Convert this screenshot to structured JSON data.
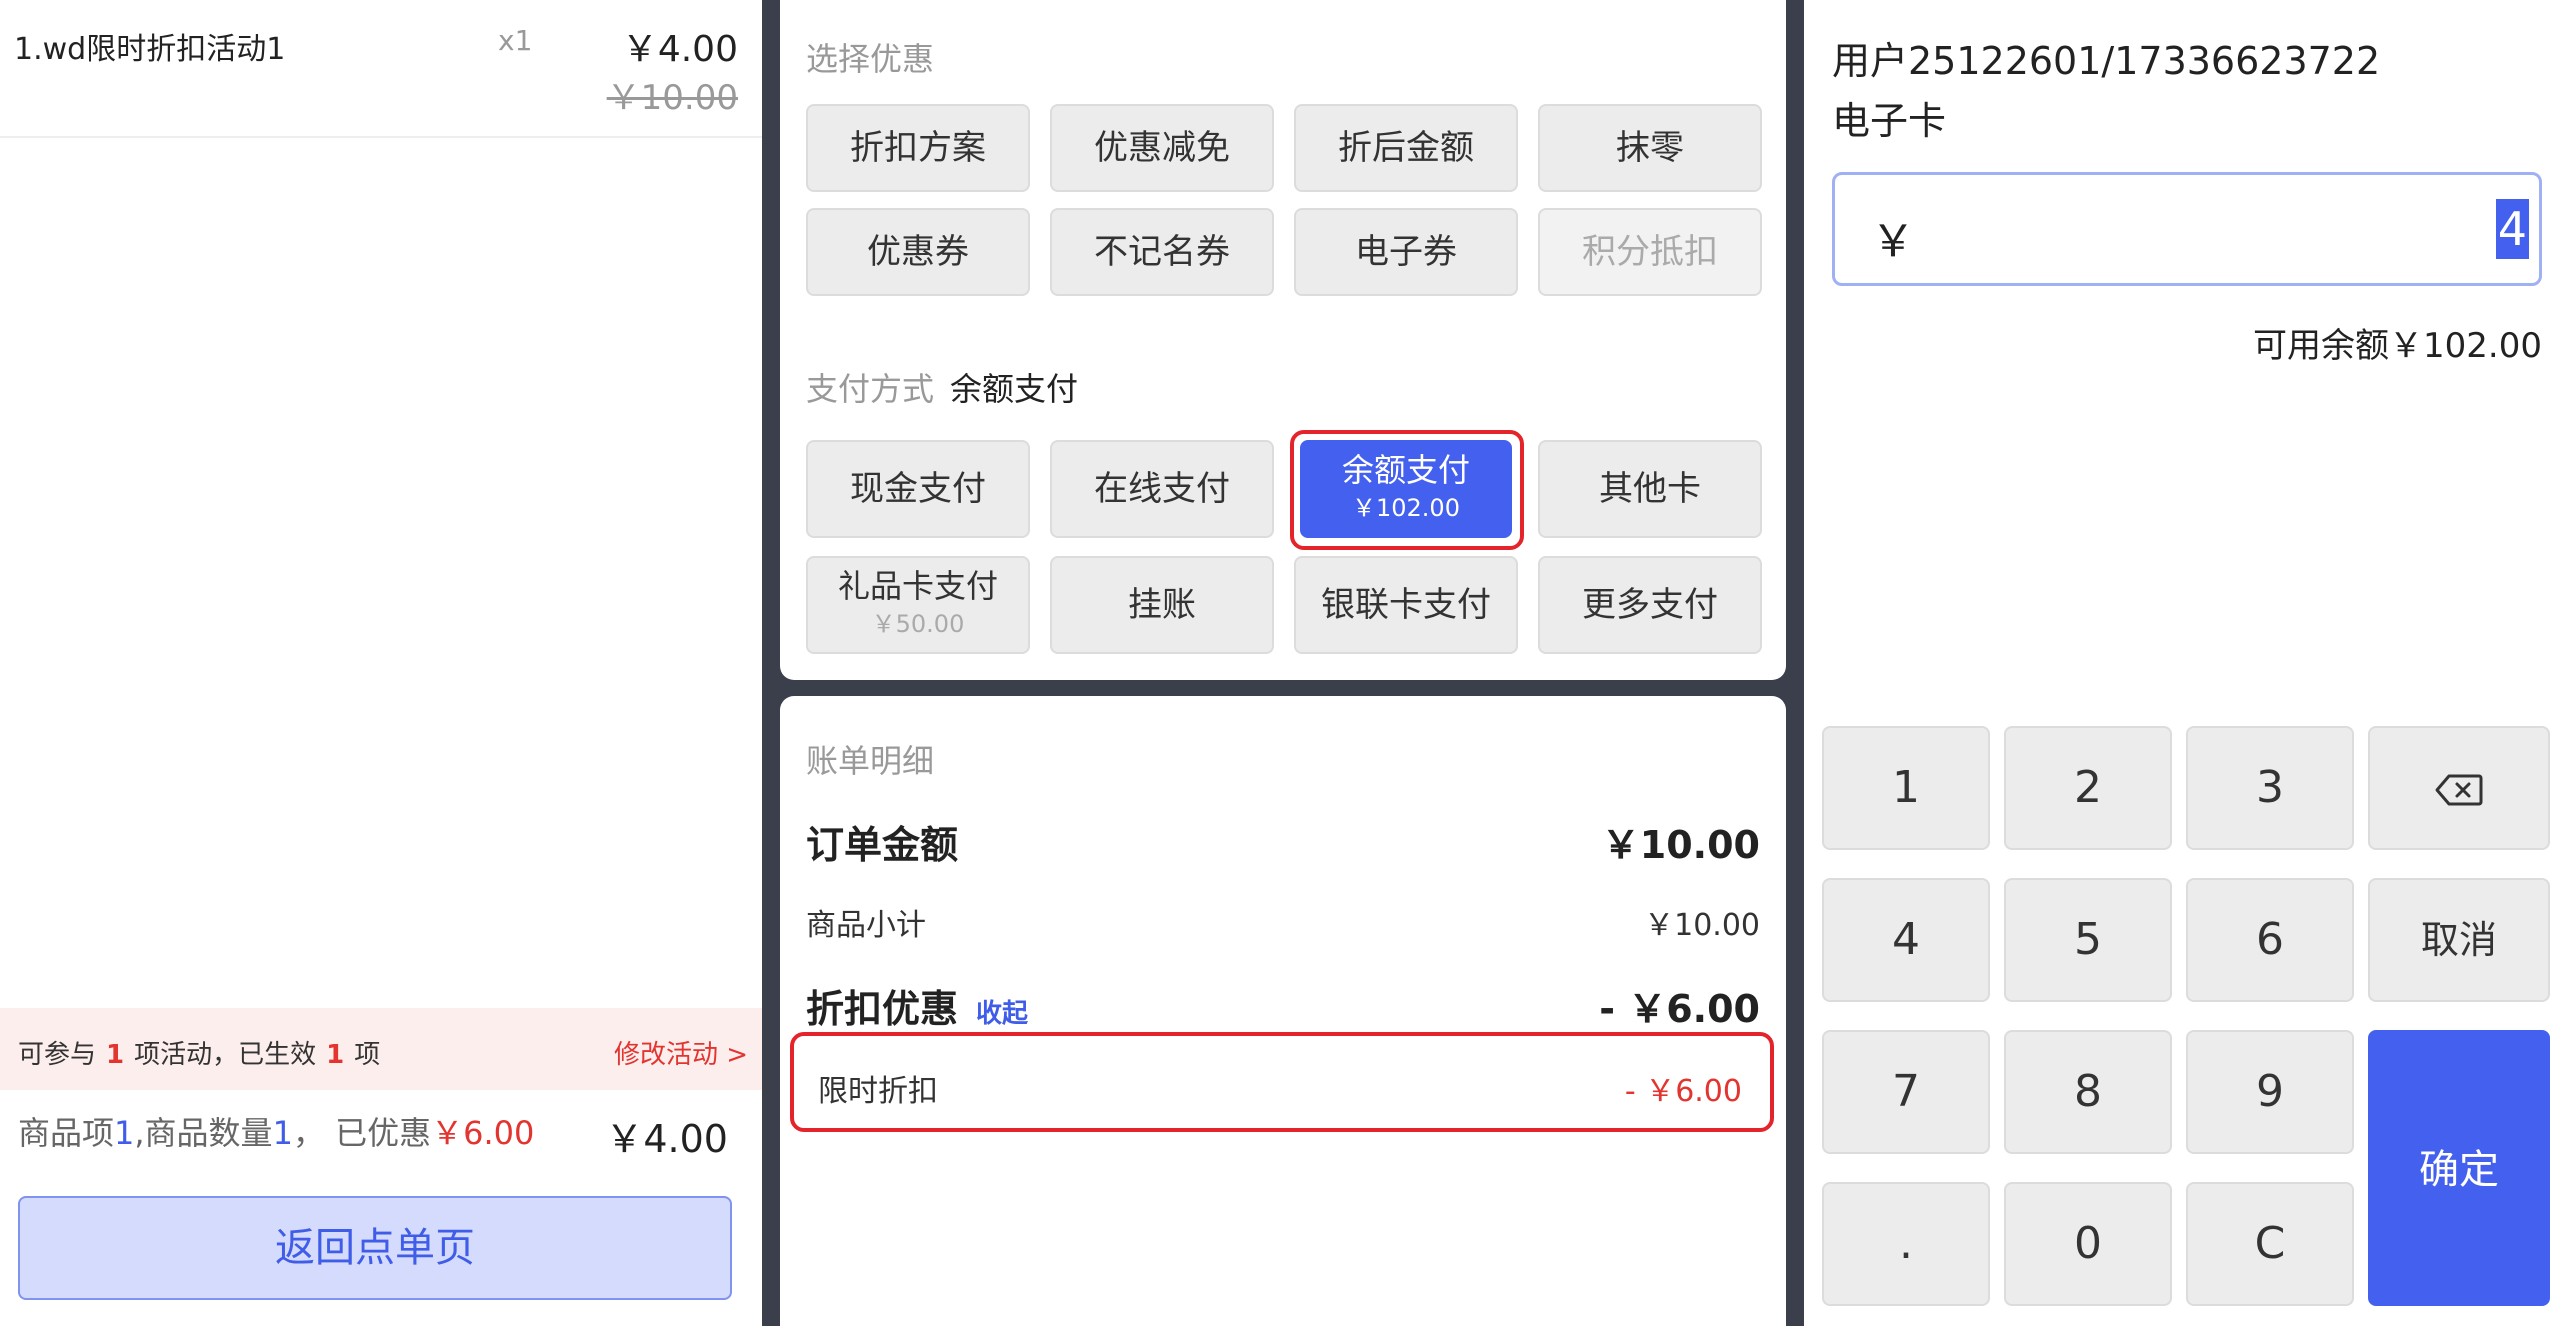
{
  "order": {
    "item_name": "1.wd限时折扣活动1",
    "item_qty": "x1",
    "item_price": "￥4.00",
    "item_original_price": "￥10.00"
  },
  "activity": {
    "prefix": "可参与",
    "count1": "1",
    "middle": "项活动，已生效",
    "count2": "1",
    "suffix": "项",
    "modify_link": "修改活动 >"
  },
  "summary": {
    "label1": "商品项",
    "item_count": "1",
    "label2": ",商品数量",
    "quantity": "1",
    "label3": "， 已优惠",
    "discount": "￥6.00",
    "total": "￥4.00"
  },
  "return_button": "返回点单页",
  "discount_section": {
    "title": "选择优惠",
    "options": [
      "折扣方案",
      "优惠减免",
      "折后金额",
      "抹零",
      "优惠券",
      "不记名券",
      "电子券",
      "积分抵扣"
    ]
  },
  "payment_section": {
    "title": "支付方式",
    "selected": "余额支付",
    "options": {
      "cash": "现金支付",
      "online": "在线支付",
      "balance": "余额支付",
      "balance_amount": "￥102.00",
      "other_card": "其他卡",
      "gift_card": "礼品卡支付",
      "gift_card_amount": "￥50.00",
      "credit": "挂账",
      "unionpay": "银联卡支付",
      "more": "更多支付"
    }
  },
  "bill": {
    "title": "账单明细",
    "order_amount_label": "订单金额",
    "order_amount": "￥10.00",
    "subtotal_label": "商品小计",
    "subtotal": "￥10.00",
    "discount_label": "折扣优惠",
    "collapse": "收起",
    "discount_total": "- ￥6.00",
    "detail_label": "限时折扣",
    "detail_amount": "- ￥6.00"
  },
  "member": {
    "user": "用户25122601/17336623722",
    "card_type": "电子卡",
    "currency": "￥",
    "amount": "4",
    "balance": "可用余额￥102.00"
  },
  "keypad": {
    "k1": "1",
    "k2": "2",
    "k3": "3",
    "k4": "4",
    "k5": "5",
    "k6": "6",
    "cancel": "取消",
    "k7": "7",
    "k8": "8",
    "k9": "9",
    "confirm": "确定",
    "dot": ".",
    "k0": "0",
    "clear": "C"
  },
  "colors": {
    "accent": "#4460ee",
    "red": "#e3342f",
    "highlight_border": "#e3242b",
    "divider": "#3a3f4b"
  }
}
